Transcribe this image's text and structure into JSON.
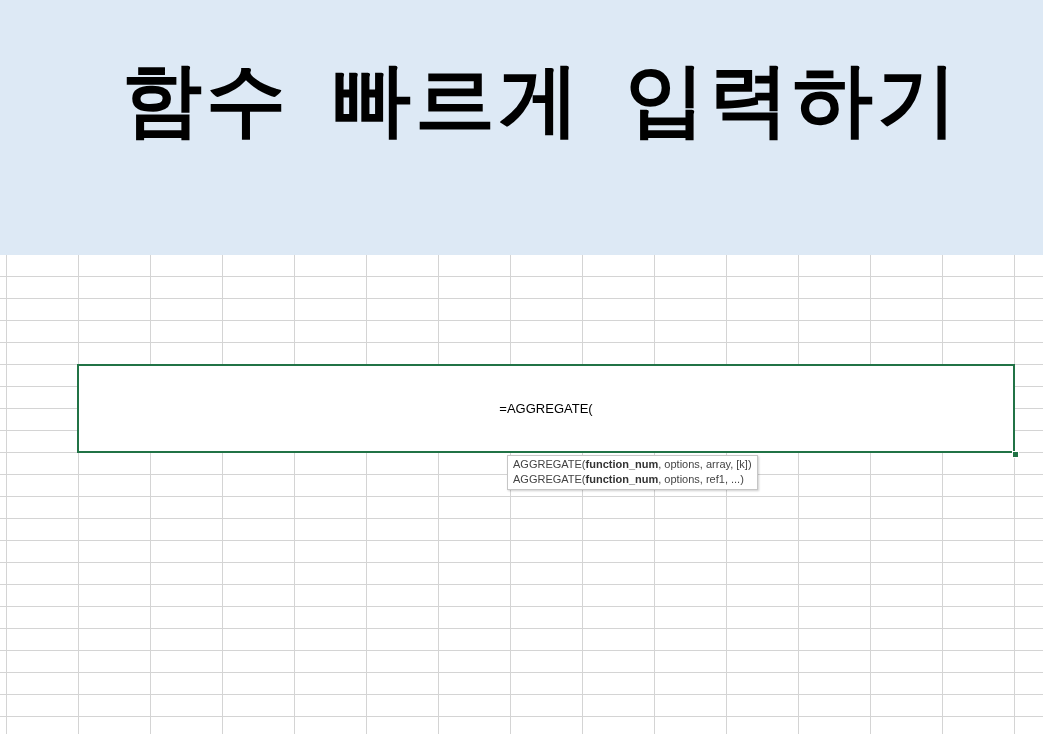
{
  "banner": {
    "title": "함수 빠르게 입력하기"
  },
  "sheet": {
    "active_cell": {
      "value": "=AGGREGATE("
    },
    "tooltip": {
      "lines": [
        "AGGREGATE(**function_num**, options, array, [k])",
        "AGGREGATE(**function_num**, options, ref1, ...)"
      ]
    }
  }
}
